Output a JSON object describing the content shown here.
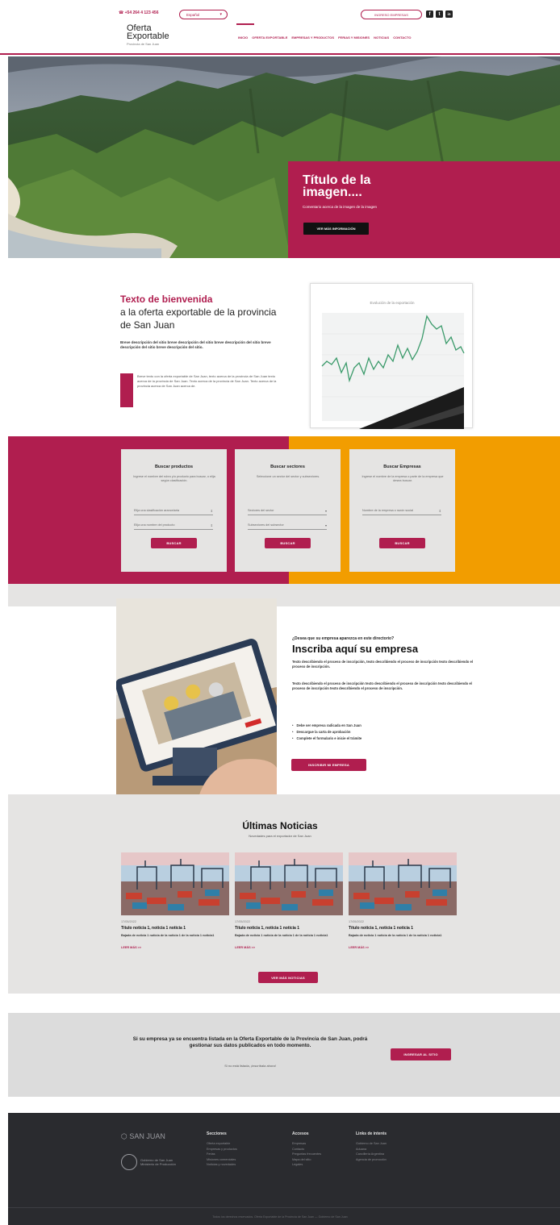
{
  "header": {
    "phone": "+54 264 4 123 456",
    "language": "Español",
    "login_button": "INGRESO EMPRESAS",
    "social": [
      {
        "icon": "facebook-icon",
        "glyph": "f"
      },
      {
        "icon": "twitter-icon",
        "glyph": "t"
      },
      {
        "icon": "linkedin-icon",
        "glyph": "in"
      }
    ],
    "logo_line1": "Oferta",
    "logo_line2": "Exportable",
    "logo_sub": "Provincia de San Juan",
    "nav": [
      "INICIO",
      "OFERTA EXPORTABLE",
      "EMPRESAS Y PRODUCTOS",
      "FERIAS Y MISIONES",
      "NOTICIAS",
      "CONTACTO"
    ]
  },
  "hero": {
    "title": "Título de la imagen....",
    "subtitle": "Comentario acerca de la imagen de la imagen",
    "button": "VER MÁS INFORMACIÓN"
  },
  "welcome": {
    "title_a": "Texto de bienvenida",
    "title_b": "a la oferta exportable de la provincia de San Juan",
    "desc": "Breve descripción del sitio breve descripción del sitio breve descripción del sitio breve descripción del sitio breve descripción del sitio.",
    "quote": "Breve texto con la oferta exportable de San Juan, texto acerca de la provincia de San Juan texto acerca de la provincia de San Juan. Texto acerca de la provincia de San Juan. Texto acerca de la provincia acerca de San Juan acerca de.",
    "chart_title": "Evolución de la exportación"
  },
  "search": {
    "cards": [
      {
        "title": "Buscar productos",
        "desc": "Ingrese el nombre del rubro y/o producto para buscar, o elija según clasificación.",
        "selects": [
          "Elija una clasificación arancelaria",
          "Elija una nombre del producto"
        ],
        "button": "BUSCAR"
      },
      {
        "title": "Buscar sectores",
        "desc": "Seleccione un sector del sector y subsectores.",
        "selects": [
          "Sectores del sector",
          "Subsectores del subsector"
        ],
        "button": "BUSCAR"
      },
      {
        "title": "Buscar Empresas",
        "desc": "Ingrese el nombre de la empresa o parte de la empresa que desea buscar.",
        "selects": [
          "Nombre de la empresa o razón social"
        ],
        "button": "BUSCAR"
      }
    ]
  },
  "register": {
    "question": "¿Desea que su empresa aparezca en este directorio?",
    "title": "Inscriba aquí su empresa",
    "p1": "Texto describiendo el proceso de inscripción, texto describiendo el proceso de inscripción texto describiendo el proceso de inscripción.",
    "p2": "Texto describiendo el proceso de inscripción texto describiendo el proceso de inscripción texto describiendo el proceso de inscripción texto describiendo el proceso de inscripción.",
    "list": [
      "Debe ser empresa radicada en San Juan",
      "Descargue la carta de aprobación",
      "Complete el formulario e inicie el trámite"
    ],
    "button": "INSCRIBIR MI EMPRESA"
  },
  "news": {
    "title": "Últimas Noticias",
    "subtitle": "Novedades para el exportador de San Juan",
    "items": [
      {
        "date": "17/05/2022",
        "title": "Título noticia 1, noticia 1 noticia 1",
        "desc": "Bajada de noticia 1 noticia de la noticia 1 de la noticia 1 noticia1",
        "more": "LEER MÁS >>"
      },
      {
        "date": "17/05/2022",
        "title": "Título noticia 1, noticia 1 noticia 1",
        "desc": "Bajada de noticia 1 noticia de la noticia 1 de la noticia 1 noticia1",
        "more": "LEER MÁS >>"
      },
      {
        "date": "17/05/2022",
        "title": "Título noticia 1, noticia 1 noticia 1",
        "desc": "Bajada de noticia 1 noticia de la noticia 1 de la noticia 1 noticia1",
        "more": "LEER MÁS >>"
      }
    ],
    "button": "VER MÁS NOTICIAS"
  },
  "cta": {
    "text": "Si su empresa ya se encuentra listada en la Oferta Exportable de la Provincia de San Juan, podrá gestionar sus datos publicados en todo momento.",
    "small": "Si no está listada, ¡inscríbala ahora!",
    "button": "INGRESAR AL SITIO"
  },
  "footer": {
    "logo1": "SAN JUAN",
    "logo2_l1": "Gobierno de San Juan",
    "logo2_l2": "Ministerio de Producción",
    "columns": [
      {
        "heading": "Secciones",
        "links": [
          "Oferta exportable",
          "Empresas y productos",
          "Ferias",
          "Misiones comerciales",
          "Noticias y novedades"
        ]
      },
      {
        "heading": "Accesos",
        "links": [
          "Empresas",
          "Contacto",
          "Preguntas frecuentes",
          "Mapa del sitio",
          "Legales"
        ]
      },
      {
        "heading": "Links de interés",
        "links": [
          "Gobierno de San Juan",
          "Aduana",
          "Cancillería Argentina",
          "Agencia de promoción"
        ]
      }
    ],
    "copyright": "Todos los derechos reservados. Oferta Exportable de la Provincia de San Juan — Gobierno de San Juan"
  },
  "colors": {
    "accent": "#b01e4f",
    "orange": "#f29d00",
    "footer": "#2a2b2f",
    "panel": "#e5e4e3"
  }
}
